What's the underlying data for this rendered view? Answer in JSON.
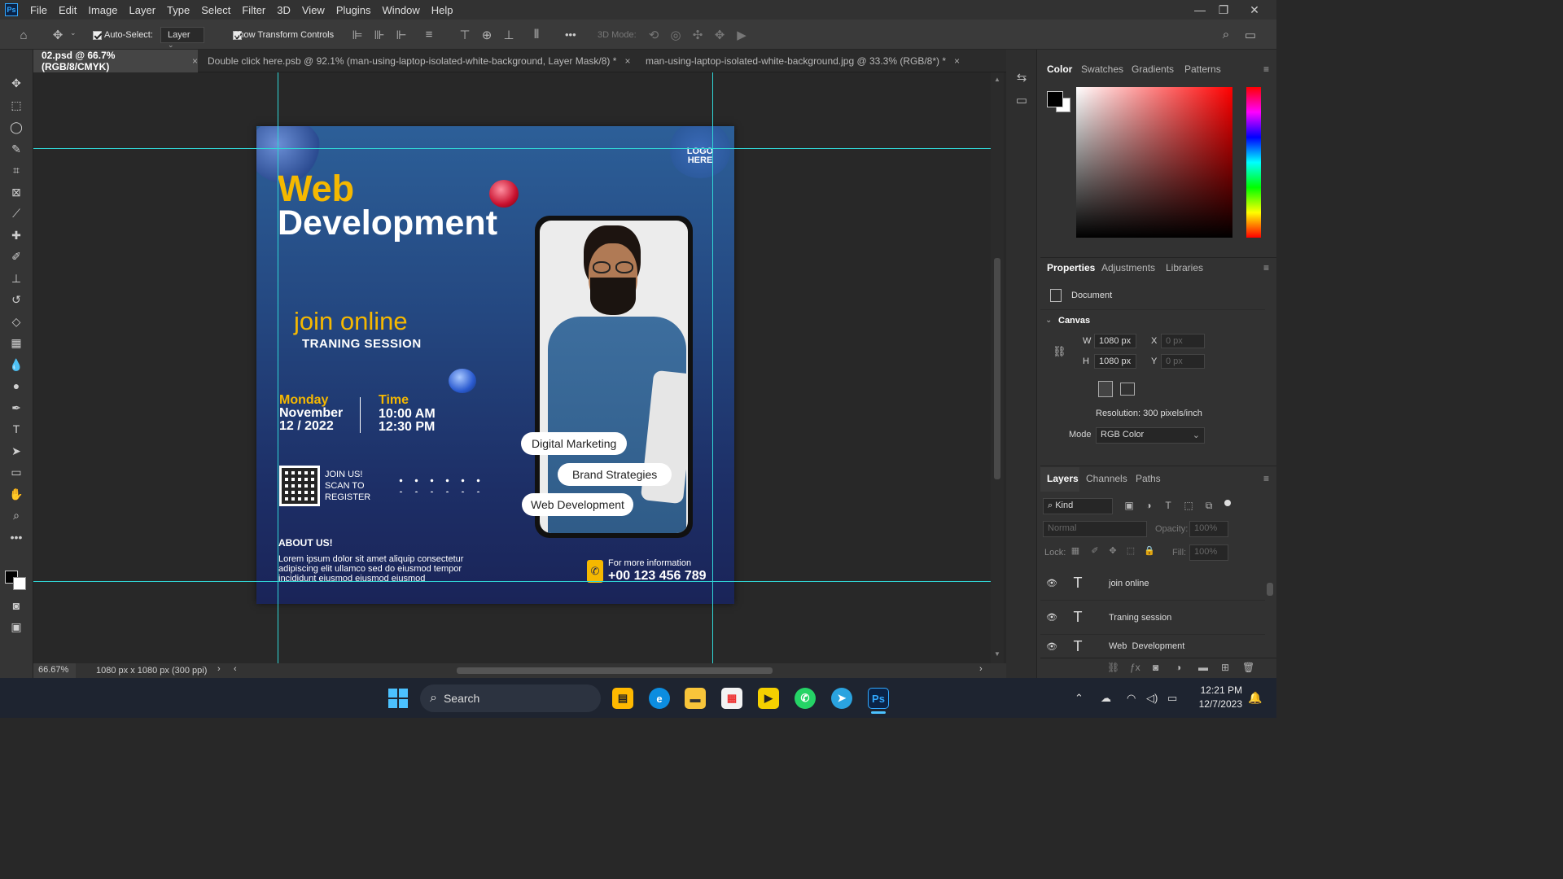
{
  "app": {
    "name": "Ps",
    "accent": "#31a8ff"
  },
  "menu": [
    "File",
    "Edit",
    "Image",
    "Layer",
    "Type",
    "Select",
    "Filter",
    "3D",
    "View",
    "Plugins",
    "Window",
    "Help"
  ],
  "options": {
    "auto_select_label": "Auto-Select:",
    "auto_select_value": "Layer",
    "show_transform": "Show Transform Controls",
    "mode_3d": "3D Mode:",
    "more": "•••"
  },
  "tabs": [
    {
      "label": "02.psd @ 66.7% (RGB/8/CMYK)"
    },
    {
      "label": "Double click here.psb @ 92.1% (man-using-laptop-isolated-white-background, Layer Mask/8) *"
    },
    {
      "label": "man-using-laptop-isolated-white-background.jpg @ 33.3% (RGB/8*) *"
    }
  ],
  "status": {
    "zoom": "66.67%",
    "doc": "1080 px x 1080 px (300 ppi)"
  },
  "artwork": {
    "logo": "LOGO HERE",
    "title1": "Web",
    "title2": "Development",
    "join": "join online",
    "session": "TRANING SESSION",
    "day": "Monday",
    "date1": "November",
    "date2": "12 / 2022",
    "time_label": "Time",
    "time1": "10:00 AM",
    "time2": "12:30 PM",
    "join_us": "JOIN US!",
    "scan": "SCAN TO",
    "register": "REGISTER",
    "about": "ABOUT US!",
    "lorem1": "Lorem ipsum dolor sit amet aliquip consectetur",
    "lorem2": "adipiscing elit ullamco sed do eiusmod tempor",
    "lorem3": "incididunt eiusmod eiusmod eiusmod",
    "pill1": "Digital Marketing",
    "pill2": "Brand Strategies",
    "pill3": "Web Development",
    "info": "For more information",
    "phone": "+00 123 456 789",
    "yellow": "#f5b800"
  },
  "color_panel": {
    "tabs": [
      "Color",
      "Swatches",
      "Gradients",
      "Patterns"
    ]
  },
  "properties": {
    "tabs": [
      "Properties",
      "Adjustments",
      "Libraries"
    ],
    "doc": "Document",
    "section": "Canvas",
    "w_label": "W",
    "w": "1080 px",
    "h_label": "H",
    "h": "1080 px",
    "x_label": "X",
    "x": "0 px",
    "y_label": "Y",
    "y": "0 px",
    "resolution": "Resolution: 300 pixels/inch",
    "mode_label": "Mode",
    "mode": "RGB Color"
  },
  "layers_panel": {
    "tabs": [
      "Layers",
      "Channels",
      "Paths"
    ],
    "kind": "Kind",
    "blend": "Normal",
    "opacity_label": "Opacity:",
    "opacity": "100%",
    "lock_label": "Lock:",
    "fill_label": "Fill:",
    "fill": "100%",
    "layers": [
      {
        "name": "join online"
      },
      {
        "name": "Traning session"
      },
      {
        "name": "Web  Development"
      }
    ]
  },
  "taskbar": {
    "search": "Search",
    "time": "12:21 PM",
    "date": "12/7/2023"
  }
}
